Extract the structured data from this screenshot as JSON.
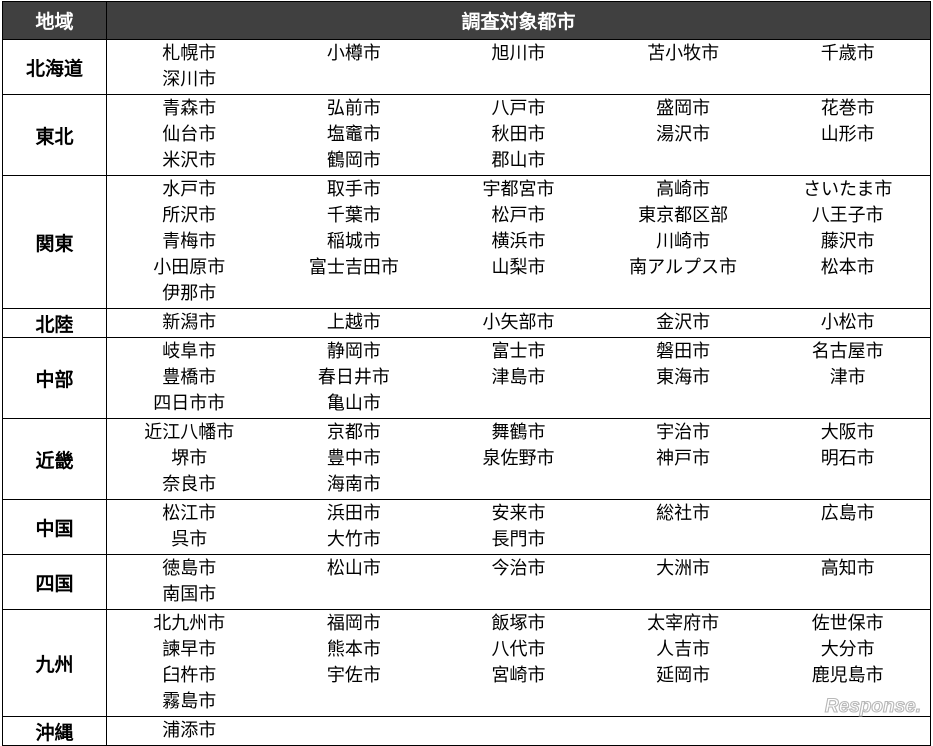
{
  "header": {
    "region": "地域",
    "cities": "調査対象都市"
  },
  "rows": [
    {
      "region": "北海道",
      "cities": [
        "札幌市",
        "小樽市",
        "旭川市",
        "苫小牧市",
        "千歳市",
        "深川市"
      ]
    },
    {
      "region": "東北",
      "cities": [
        "青森市",
        "弘前市",
        "八戸市",
        "盛岡市",
        "花巻市",
        "仙台市",
        "塩竈市",
        "秋田市",
        "湯沢市",
        "山形市",
        "米沢市",
        "鶴岡市",
        "郡山市"
      ]
    },
    {
      "region": "関東",
      "cities": [
        "水戸市",
        "取手市",
        "宇都宮市",
        "高崎市",
        "さいたま市",
        "所沢市",
        "千葉市",
        "松戸市",
        "東京都区部",
        "八王子市",
        "青梅市",
        "稲城市",
        "横浜市",
        "川崎市",
        "藤沢市",
        "小田原市",
        "富士吉田市",
        "山梨市",
        "南アルプス市",
        "松本市",
        "伊那市"
      ]
    },
    {
      "region": "北陸",
      "cities": [
        "新潟市",
        "上越市",
        "小矢部市",
        "金沢市",
        "小松市"
      ]
    },
    {
      "region": "中部",
      "cities": [
        "岐阜市",
        "静岡市",
        "富士市",
        "磐田市",
        "名古屋市",
        "豊橋市",
        "春日井市",
        "津島市",
        "東海市",
        "津市",
        "四日市市",
        "亀山市"
      ]
    },
    {
      "region": "近畿",
      "cities": [
        "近江八幡市",
        "京都市",
        "舞鶴市",
        "宇治市",
        "大阪市",
        "堺市",
        "豊中市",
        "泉佐野市",
        "神戸市",
        "明石市",
        "奈良市",
        "海南市"
      ]
    },
    {
      "region": "中国",
      "cities": [
        "松江市",
        "浜田市",
        "安来市",
        "総社市",
        "広島市",
        "呉市",
        "大竹市",
        "長門市"
      ]
    },
    {
      "region": "四国",
      "cities": [
        "徳島市",
        "松山市",
        "今治市",
        "大洲市",
        "高知市",
        "南国市"
      ]
    },
    {
      "region": "九州",
      "cities": [
        "北九州市",
        "福岡市",
        "飯塚市",
        "太宰府市",
        "佐世保市",
        "諫早市",
        "熊本市",
        "八代市",
        "人吉市",
        "大分市",
        "臼杵市",
        "宇佐市",
        "宮崎市",
        "延岡市",
        "鹿児島市",
        "霧島市"
      ]
    },
    {
      "region": "沖縄",
      "cities": [
        "浦添市"
      ]
    }
  ],
  "watermark": {
    "text": "Response.",
    "color": "#b8b8b8"
  }
}
